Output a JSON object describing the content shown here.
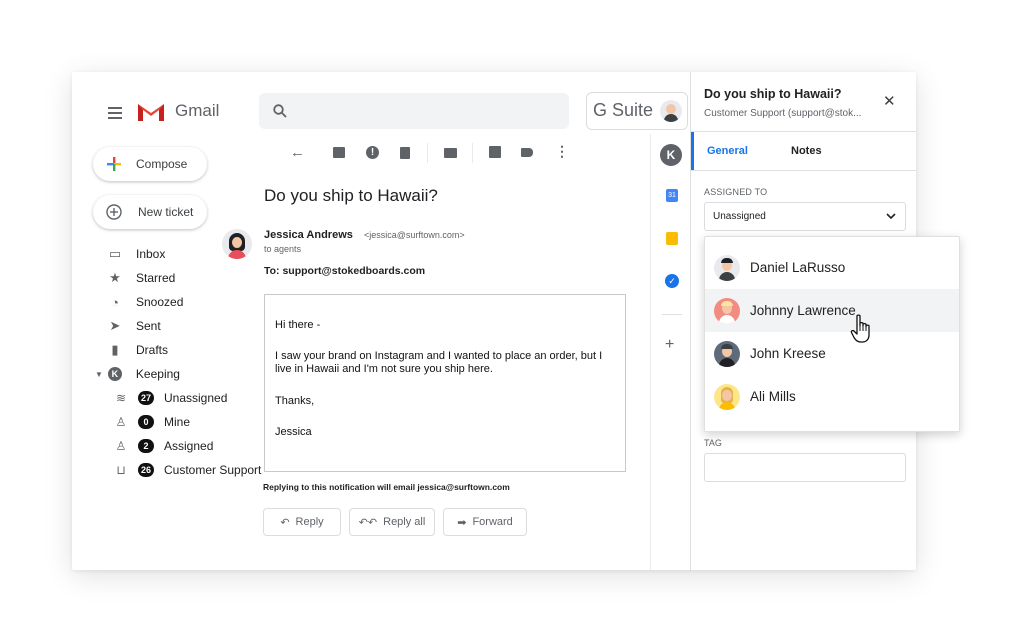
{
  "header": {
    "app_name": "Gmail",
    "gsuite_label": "G Suite"
  },
  "sidebar": {
    "compose_label": "Compose",
    "new_ticket_label": "New ticket",
    "items": [
      {
        "label": "Inbox"
      },
      {
        "label": "Starred"
      },
      {
        "label": "Snoozed"
      },
      {
        "label": "Sent"
      },
      {
        "label": "Drafts"
      },
      {
        "label": "Keeping"
      }
    ],
    "keeping_items": [
      {
        "label": "Unassigned",
        "count": "27"
      },
      {
        "label": "Mine",
        "count": "0"
      },
      {
        "label": "Assigned",
        "count": "2"
      },
      {
        "label": "Customer Support",
        "count": "26"
      }
    ]
  },
  "email": {
    "subject": "Do you ship to Hawaii?",
    "sender_name": "Jessica Andrews",
    "sender_email": "<jessica@surftown.com>",
    "to_agents": "to agents",
    "to_line": "To: support@stokedboards.com",
    "body": {
      "greeting": "Hi there -",
      "paragraph": "I saw your brand on Instagram and I wanted to place an order, but I live in Hawaii and I'm not sure you ship here.",
      "thanks": "Thanks,",
      "signature": "Jessica"
    },
    "reply_notice": "Replying to this notification will email jessica@surftown.com",
    "actions": {
      "reply": "Reply",
      "reply_all": "Reply all",
      "forward": "Forward"
    }
  },
  "panel": {
    "title": "Do you ship to Hawaii?",
    "subtitle": "Customer Support (support@stok...",
    "tabs": {
      "general": "General",
      "notes": "Notes"
    },
    "assigned_to_label": "ASSIGNED TO",
    "assigned_value": "Unassigned",
    "tag_label": "TAG",
    "options": [
      {
        "name": "Daniel LaRusso",
        "color": "#e8eaed"
      },
      {
        "name": "Johnny Lawrence",
        "color": "#f28b82"
      },
      {
        "name": "John Kreese",
        "color": "#5f6b7a"
      },
      {
        "name": "Ali Mills",
        "color": "#fde68a"
      }
    ]
  },
  "colors": {
    "accent": "#1a73e8",
    "gmail_red": "#ea4335",
    "hover_row": "#f1f3f4"
  }
}
